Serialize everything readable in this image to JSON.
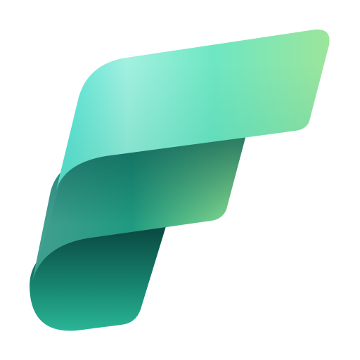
{
  "logo": {
    "name": "fabric-f-logo",
    "icon": "stylized-letter-f-ribbon-icon",
    "colors": {
      "top_light": "#9ef0dc",
      "top_cyan": "#63e4d7",
      "top_green": "#92e49a",
      "middle_teal": "#2ea88c",
      "middle_dark": "#1a7a6a",
      "middle_green": "#7fdc8e",
      "bottom_dark": "#0e5a4f",
      "bottom_teal": "#2db394"
    }
  }
}
